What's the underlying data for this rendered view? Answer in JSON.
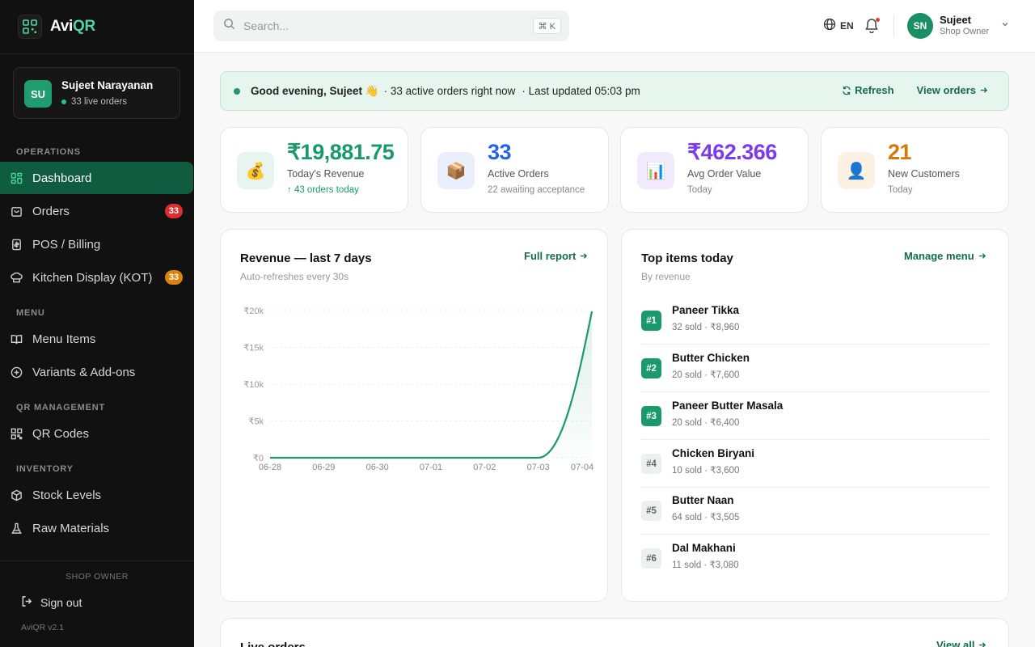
{
  "app": {
    "name_prefix": "Avi",
    "name_suffix": "QR",
    "version": "AviQR v2.1"
  },
  "sidebar": {
    "user": {
      "initials": "SU",
      "name": "Sujeet Narayanan",
      "live": "33 live orders"
    },
    "sections": {
      "operations": "OPERATIONS",
      "menu": "MENU",
      "qr": "QR MANAGEMENT",
      "inventory": "INVENTORY"
    },
    "items": {
      "dashboard": "Dashboard",
      "orders": "Orders",
      "orders_badge": "33",
      "pos": "POS / Billing",
      "kot": "Kitchen Display (KOT)",
      "kot_badge": "33",
      "menu_items": "Menu Items",
      "variants": "Variants & Add-ons",
      "qr_codes": "QR Codes",
      "stock": "Stock Levels",
      "raw": "Raw Materials"
    },
    "footer": {
      "role": "SHOP OWNER",
      "signout": "Sign out"
    }
  },
  "topbar": {
    "search_placeholder": "Search...",
    "shortcut": "⌘ K",
    "lang": "EN",
    "user": {
      "initials": "SN",
      "name": "Sujeet",
      "role": "Shop Owner"
    }
  },
  "greeting": {
    "hello": "Good evening, Sujeet 👋",
    "active": "· 33 active orders right now",
    "updated": "· Last updated 05:03 pm",
    "refresh": "Refresh",
    "view_orders": "View orders"
  },
  "stats": [
    {
      "icon": "money-bag-icon",
      "value": "₹19,881.75",
      "label": "Today's Revenue",
      "sub": "↑ 43 orders today",
      "color": "#1a9a6a",
      "sub_color": "#1a9a6a",
      "bg": "#e7f5ee"
    },
    {
      "icon": "package-icon",
      "value": "33",
      "label": "Active Orders",
      "sub": "22 awaiting acceptance",
      "color": "#2563eb",
      "sub_color": "#888888",
      "bg": "#e8eefc"
    },
    {
      "icon": "bar-chart-icon",
      "value": "₹462.366",
      "label": "Avg Order Value",
      "sub": "Today",
      "color": "#7c3aed",
      "sub_color": "#888888",
      "bg": "#f0eafc"
    },
    {
      "icon": "user-icon",
      "value": "21",
      "label": "New Customers",
      "sub": "Today",
      "color": "#d97706",
      "sub_color": "#888888",
      "bg": "#fcf1e3"
    }
  ],
  "revenue_panel": {
    "title": "Revenue — last 7 days",
    "subtitle": "Auto-refreshes every 30s",
    "link": "Full report"
  },
  "chart_data": {
    "type": "area",
    "title": "Revenue — last 7 days",
    "categories": [
      "06-28",
      "06-29",
      "06-30",
      "07-01",
      "07-02",
      "07-03",
      "07-04"
    ],
    "values": [
      0,
      0,
      0,
      0,
      0,
      0,
      19881.75
    ],
    "yticks": [
      "₹0",
      "₹5k",
      "₹10k",
      "₹15k",
      "₹20k"
    ],
    "ylim": [
      0,
      20000
    ],
    "color": "#1a9a6a"
  },
  "top_items": {
    "title": "Top items today",
    "subtitle": "By revenue",
    "link": "Manage menu",
    "items": [
      {
        "rank": "#1",
        "name": "Paneer Tikka",
        "stat": "32 sold · ₹8,960"
      },
      {
        "rank": "#2",
        "name": "Butter Chicken",
        "stat": "20 sold · ₹7,600"
      },
      {
        "rank": "#3",
        "name": "Paneer Butter Masala",
        "stat": "20 sold · ₹6,400"
      },
      {
        "rank": "#4",
        "name": "Chicken Biryani",
        "stat": "10 sold · ₹3,600"
      },
      {
        "rank": "#5",
        "name": "Butter Naan",
        "stat": "64 sold · ₹3,505"
      },
      {
        "rank": "#6",
        "name": "Dal Makhani",
        "stat": "11 sold · ₹3,080"
      }
    ]
  },
  "live_orders": {
    "title": "Live orders",
    "link": "View all"
  }
}
